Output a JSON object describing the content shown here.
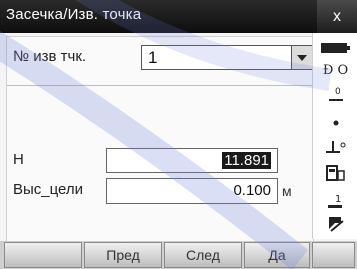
{
  "window": {
    "title": "Засечка/Изв. точка",
    "close_label": "x"
  },
  "form": {
    "point_label": "№ изв тчк.",
    "point_value": "1",
    "h_label": "H",
    "h_value": "11.891",
    "target_label": "Выс_цели",
    "target_value": "0.100",
    "target_unit": "м"
  },
  "sidepanel": {
    "icons": [
      "battery-icon",
      "prism-mode-icon",
      "tilt-icon",
      "laser-point-icon",
      "target-height-icon",
      "memory-icon",
      "keyboard-mode-icon",
      "stylus-icon"
    ],
    "mode_text": "Ð O",
    "zero_text": "0",
    "one_text": "1"
  },
  "softkeys": [
    "",
    "Пред",
    "След",
    "Да",
    ""
  ]
}
